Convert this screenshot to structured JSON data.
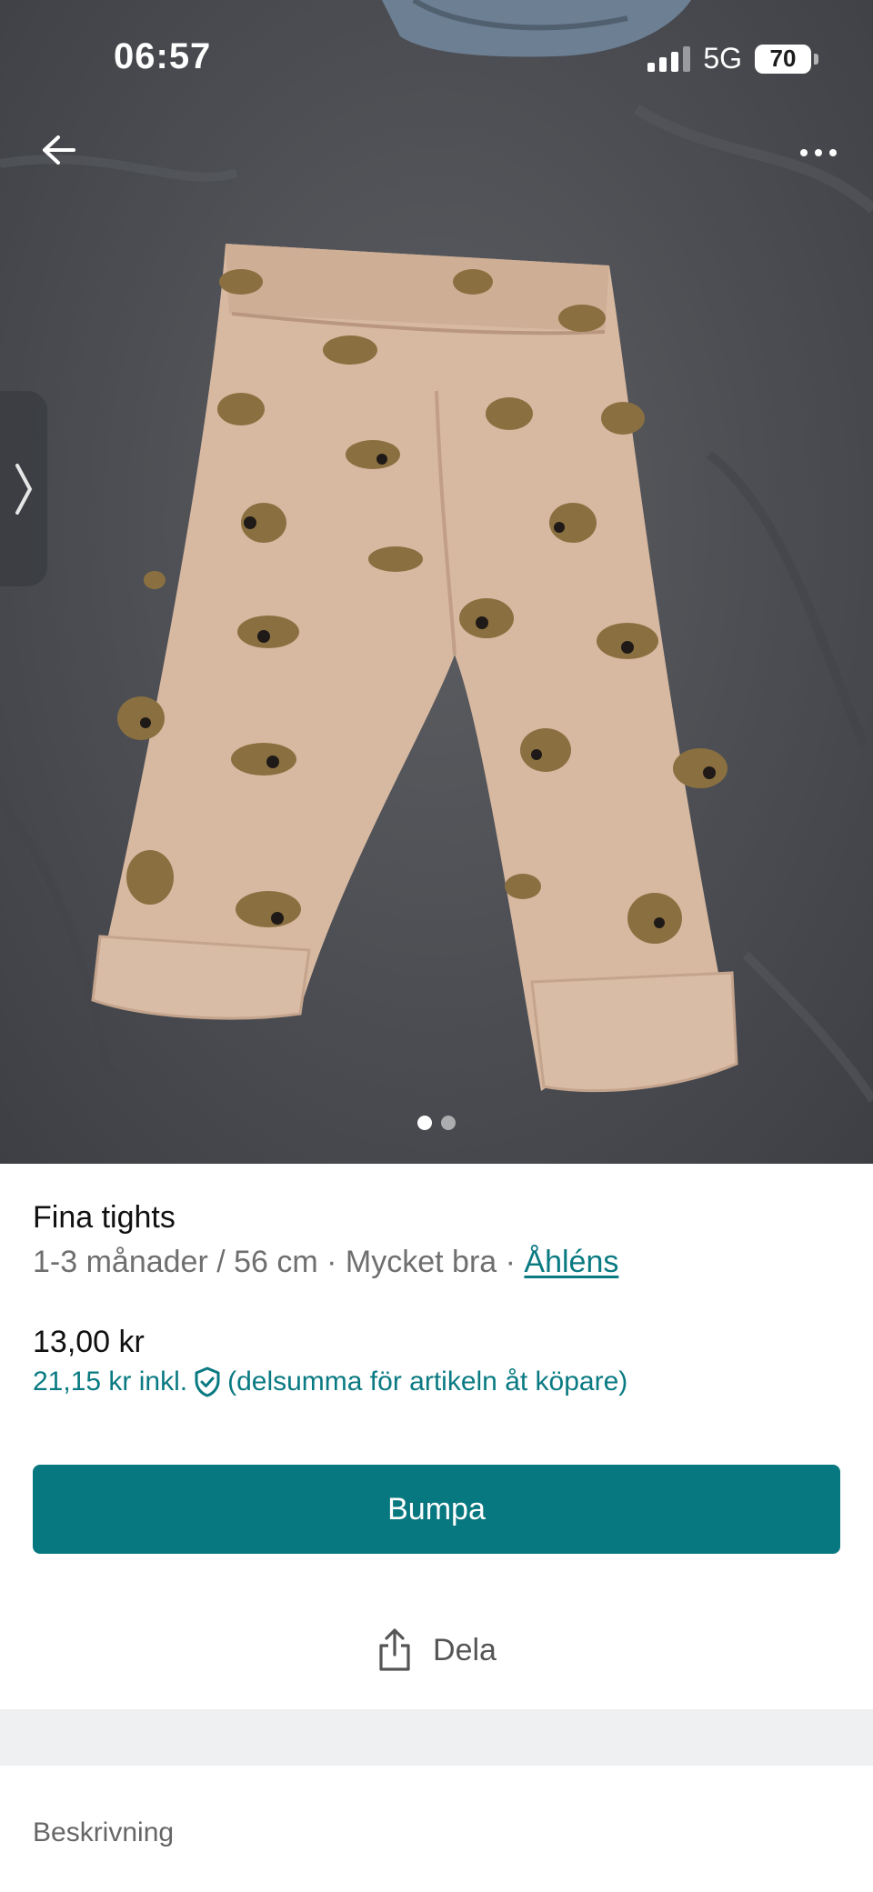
{
  "status_bar": {
    "time": "06:57",
    "network": "5G",
    "battery": "70"
  },
  "top_nav": {
    "back_icon": "arrow-left-icon",
    "more_icon": "more-horizontal-icon"
  },
  "gallery": {
    "image_count": 2,
    "active_index": 0,
    "side_tab_icon": "chevron-right-icon"
  },
  "item": {
    "title": "Fina tights",
    "size_condition": "1-3 månader / 56 cm · Mycket bra · ",
    "brand": "Åhléns",
    "price": "13,00 kr",
    "price_incl_prefix": "21,15 kr inkl.",
    "price_incl_suffix": "(delsumma för artikeln åt köpare)",
    "protection_icon": "shield-check-icon"
  },
  "actions": {
    "bump_label": "Bumpa",
    "share_label": "Dela",
    "share_icon": "share-icon"
  },
  "sections": {
    "description_label": "Beskrivning"
  },
  "colors": {
    "accent": "#087880",
    "link": "#0a7a82"
  }
}
